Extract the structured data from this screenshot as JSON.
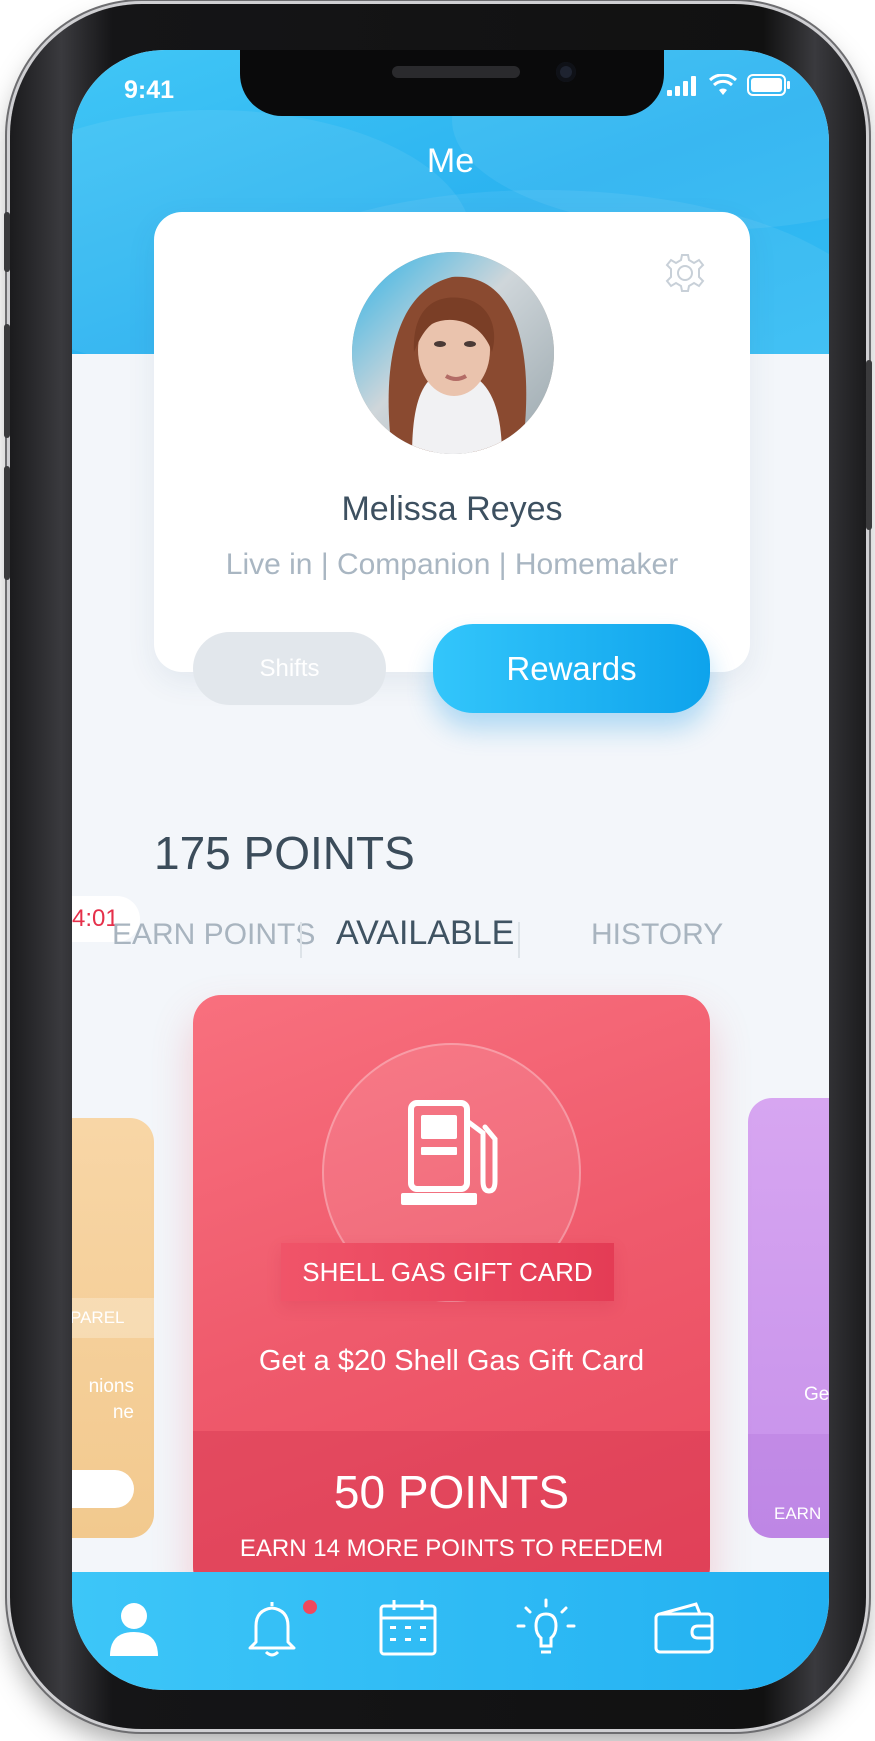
{
  "status_bar": {
    "time": "9:41"
  },
  "header": {
    "title": "Me"
  },
  "profile": {
    "name": "Melissa Reyes",
    "roles": "Live in | Companion | Homemaker"
  },
  "tabs": {
    "shifts": "Shifts",
    "rewards": "Rewards"
  },
  "points": {
    "total": "175 POINTS",
    "timer": "4:01"
  },
  "subtabs": {
    "earn": "EARN POINTS",
    "available": "AVAILABLE",
    "history": "HISTORY"
  },
  "cards": {
    "left": {
      "tag": "PAREL",
      "desc_line1": "nions",
      "desc_line2": "ne"
    },
    "main": {
      "icon": "gas-pump-icon",
      "title": "SHELL GAS GIFT CARD",
      "description": "Get a $20 Shell Gas Gift Card",
      "points": "50 POINTS",
      "earn_more": "EARN 14 MORE POINTS TO REEDEM",
      "color": "#ef5a6c"
    },
    "right": {
      "desc": "Ge",
      "earn": "EARN"
    }
  },
  "tab_bar": {
    "items": [
      "user-icon",
      "bell-icon",
      "calendar-icon",
      "lightbulb-icon",
      "wallet-icon"
    ],
    "notification_color": "#f0485d"
  },
  "colors": {
    "accent": "#22b0f1",
    "card_red": "#ef5a6c",
    "card_orange": "#f2c98e",
    "card_purple": "#c690ea"
  }
}
